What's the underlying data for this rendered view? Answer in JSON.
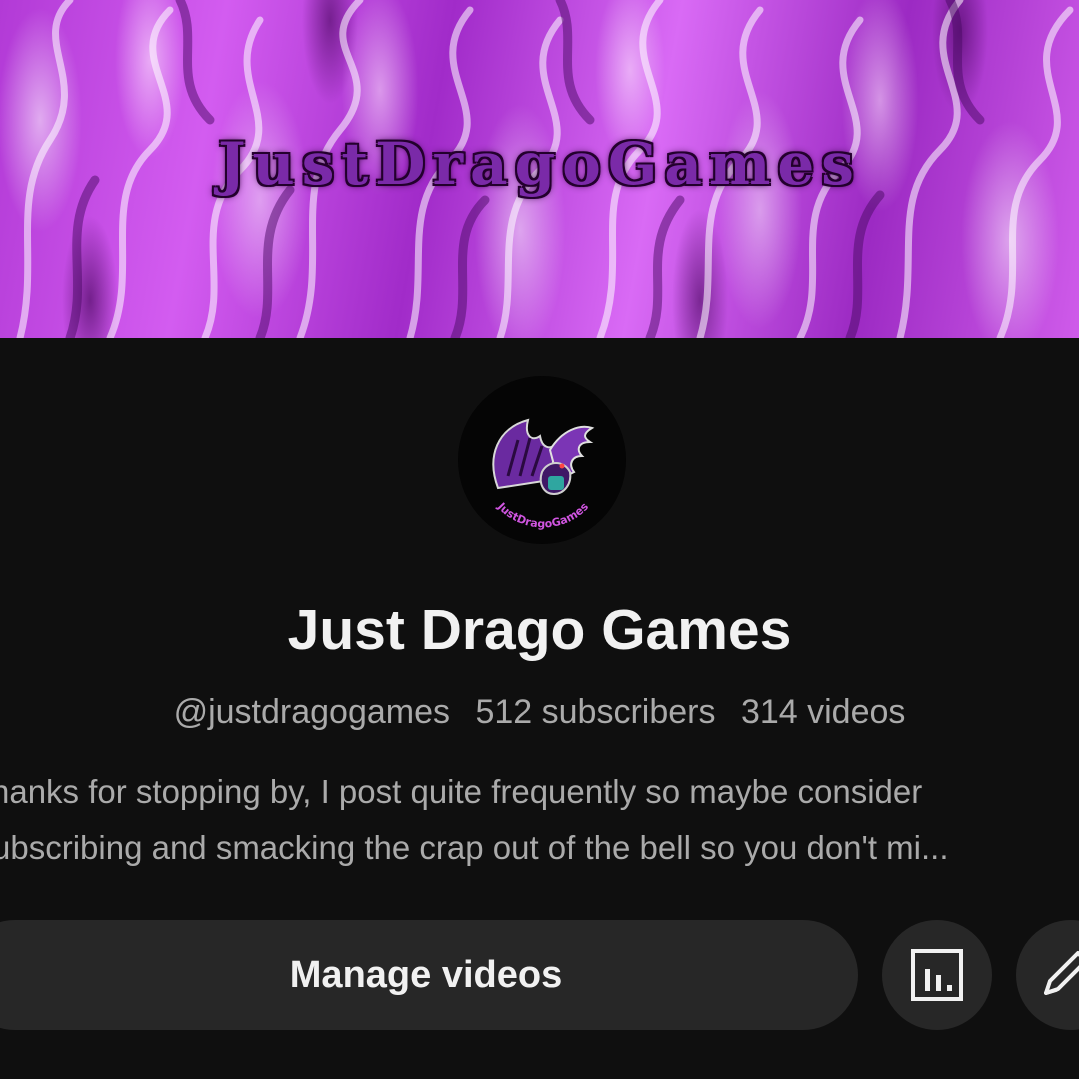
{
  "banner": {
    "title": "JustDragoGames"
  },
  "avatar": {
    "logo_text": "JustDragoGames"
  },
  "channel": {
    "name": "Just Drago Games",
    "handle": "@justdragogames",
    "subscribers": "512 subscribers",
    "videos": "314 videos",
    "description_line_1": "hanks for stopping by, I post quite frequently so maybe consider",
    "description_line_2": "ubscribing and smacking the crap out of the bell so you don't mi..."
  },
  "actions": {
    "manage_videos_label": "Manage videos",
    "analytics_icon": "analytics-icon",
    "edit_icon": "pencil-icon"
  },
  "colors": {
    "background": "#0f0f0f",
    "button_bg": "#272727",
    "primary_text": "#f1f1f1",
    "secondary_text": "#aaaaaa",
    "banner_purple": "#b23ad6"
  }
}
